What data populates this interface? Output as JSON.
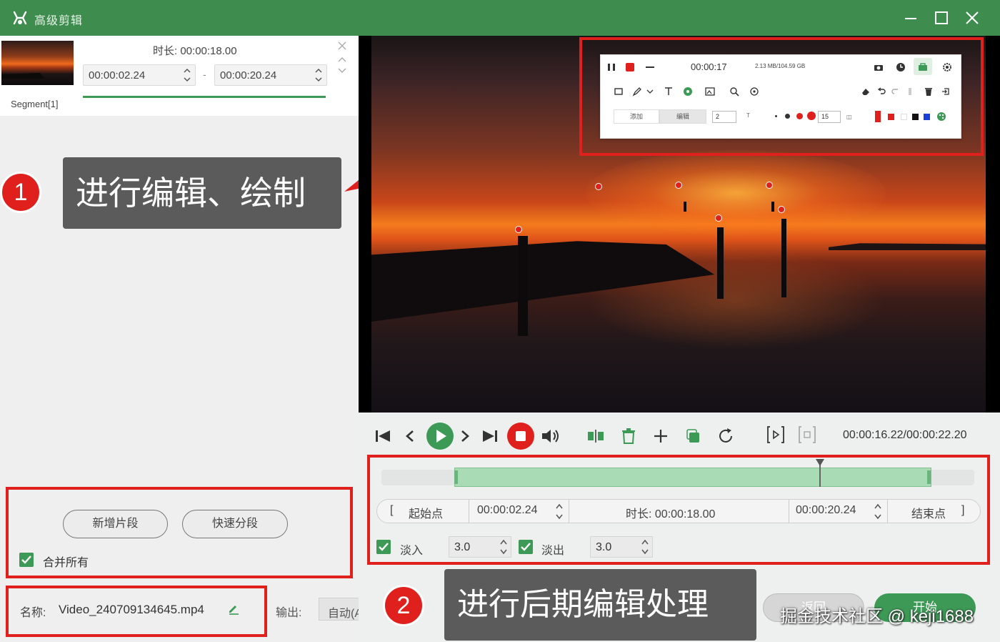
{
  "app": {
    "title": "高级剪辑",
    "accent_color": "#3f8c4f"
  },
  "segment": {
    "label": "Segment[1]",
    "duration_label": "时长:",
    "duration_value": "00:00:18.00",
    "start": "00:00:02.24",
    "end": "00:00:20.24",
    "separator": "-"
  },
  "callouts": [
    {
      "number": "1",
      "text": "进行编辑、绘制"
    },
    {
      "number": "2",
      "text": "进行后期编辑处理"
    }
  ],
  "left_actions": {
    "add_segment": "新增片段",
    "quick_split": "快速分段",
    "merge_all": "合并所有"
  },
  "file": {
    "name_label": "名称:",
    "name_value": "Video_240709134645.mp4",
    "output_label": "输出:",
    "output_value": "自动(Auto)"
  },
  "toolbar": {
    "time": "00:00:17",
    "size": "2.13 MB/104.59 GB",
    "tab_add": "添加",
    "tab_edit": "编辑",
    "font_size": "2",
    "pen_size": "15",
    "colors": [
      "#e0201c",
      "#e0201c",
      "#ffffff",
      "#111111",
      "#1a3fd6"
    ]
  },
  "player": {
    "timecode": "00:00:16.22/00:00:22.20"
  },
  "range": {
    "start_label": "起始点",
    "start_value": "00:00:02.24",
    "duration_label": "时长:",
    "duration_value": "00:00:18.00",
    "end_value": "00:00:20.24",
    "end_label": "结束点",
    "bracket_open": "[",
    "bracket_close": "]"
  },
  "fade": {
    "fade_in_label": "淡入",
    "fade_in_value": "3.0",
    "fade_out_label": "淡出",
    "fade_out_value": "3.0"
  },
  "buttons": {
    "prev": "返回",
    "start": "开始"
  },
  "watermark": "掘金技术社区 @ keji1688"
}
